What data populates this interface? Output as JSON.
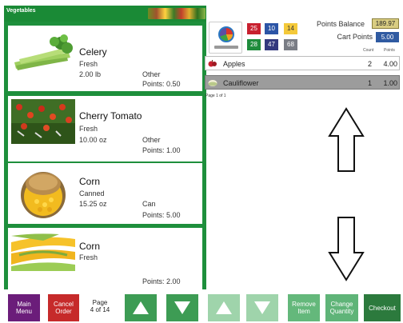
{
  "left_panel": {
    "title": "Vegetables",
    "products": [
      {
        "name": "Celery",
        "form": "Fresh",
        "quantity": "2.00 lb",
        "category": "Other",
        "points": "Points: 0.50"
      },
      {
        "name": "Cherry Tomato",
        "form": "Fresh",
        "quantity": "10.00 oz",
        "category": "Other",
        "points": "Points: 1.00"
      },
      {
        "name": "Corn",
        "form": "Canned",
        "quantity": "15.25 oz",
        "category": "Can",
        "points": "Points: 5.00"
      },
      {
        "name": "Corn",
        "form": "Fresh",
        "quantity": "",
        "category": "",
        "points": "Points: 2.00"
      }
    ]
  },
  "header": {
    "badges": [
      "25",
      "10",
      "14",
      "28",
      "47",
      "68"
    ],
    "points_balance_label": "Points Balance",
    "points_balance_value": "189.97",
    "cart_points_label": "Cart Points",
    "cart_points_value": "5.00",
    "col_count": "Count",
    "col_points": "Points"
  },
  "cart": {
    "items": [
      {
        "name": "Apples",
        "count": "2",
        "points": "4.00",
        "selected": false
      },
      {
        "name": "Cauliflower",
        "count": "1",
        "points": "1.00",
        "selected": true
      }
    ],
    "pager": "Page 1 of 1"
  },
  "toolbar": {
    "main_menu": "Main\nMenu",
    "cancel_order": "Cancel\nOrder",
    "page_label": "Page\n4 of 14",
    "remove_item": "Remove\nItem",
    "change_quantity": "Change\nQuantity",
    "checkout": "Checkout"
  },
  "icons": {
    "plate": "myplate-logo-icon",
    "scroll_up": "arrow-up-icon",
    "scroll_down": "arrow-down-icon"
  },
  "colors": {
    "panel_green": "#1e8f3c",
    "main_menu": "#6b1d7a",
    "cancel": "#c62a2a",
    "checkout": "#2c7a3d"
  }
}
